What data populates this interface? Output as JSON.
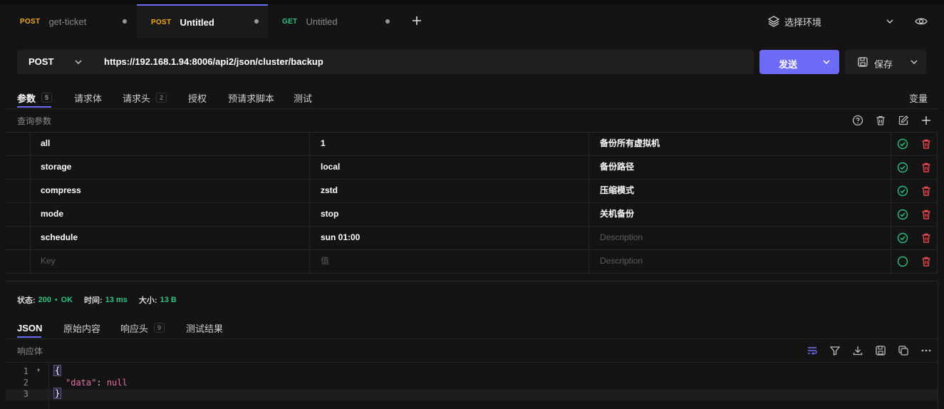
{
  "tabs": [
    {
      "method": "POST",
      "name": "get-ticket"
    },
    {
      "method": "POST",
      "name": "Untitled"
    },
    {
      "method": "GET",
      "name": "Untitled"
    }
  ],
  "add_tab_icon": "plus-icon",
  "environment": {
    "label": "选择环境"
  },
  "request": {
    "method": "POST",
    "url": "https://192.168.1.94:8006/api2/json/cluster/backup",
    "send_label": "发送",
    "save_label": "保存"
  },
  "request_tabs": [
    {
      "label": "参数",
      "badge": "5"
    },
    {
      "label": "请求体",
      "badge": ""
    },
    {
      "label": "请求头",
      "badge": "2"
    },
    {
      "label": "授权",
      "badge": ""
    },
    {
      "label": "预请求脚本",
      "badge": ""
    },
    {
      "label": "测试",
      "badge": ""
    }
  ],
  "variables_label": "变量",
  "query_params_label": "查询参数",
  "params": [
    {
      "key": "all",
      "value": "1",
      "description": "备份所有虚拟机"
    },
    {
      "key": "storage",
      "value": "local",
      "description": "备份路径"
    },
    {
      "key": "compress",
      "value": "zstd",
      "description": "压缩模式"
    },
    {
      "key": "mode",
      "value": "stop",
      "description": "关机备份"
    },
    {
      "key": "schedule",
      "value": "sun 01:00",
      "description": ""
    }
  ],
  "placeholders": {
    "key": "Key",
    "value": "值",
    "description": "Description"
  },
  "response": {
    "status_label": "状态:",
    "status_value": "200",
    "status_text": "OK",
    "time_label": "时间:",
    "time_value": "13 ms",
    "size_label": "大小:",
    "size_value": "13 B",
    "tabs": [
      {
        "label": "JSON",
        "badge": ""
      },
      {
        "label": "原始内容",
        "badge": ""
      },
      {
        "label": "响应头",
        "badge": "9"
      },
      {
        "label": "测试结果",
        "badge": ""
      }
    ],
    "body_label": "响应体",
    "code_lines": [
      {
        "no": "1",
        "text": "{"
      },
      {
        "no": "2",
        "key": "\"data\"",
        "sep": ": ",
        "val": "null"
      },
      {
        "no": "3",
        "text": "}"
      }
    ]
  },
  "colors": {
    "accent": "#6d6af6",
    "post": "#f5a623",
    "get": "#2ec27e",
    "ok": "#2ec27e",
    "delete": "#e5484d"
  }
}
